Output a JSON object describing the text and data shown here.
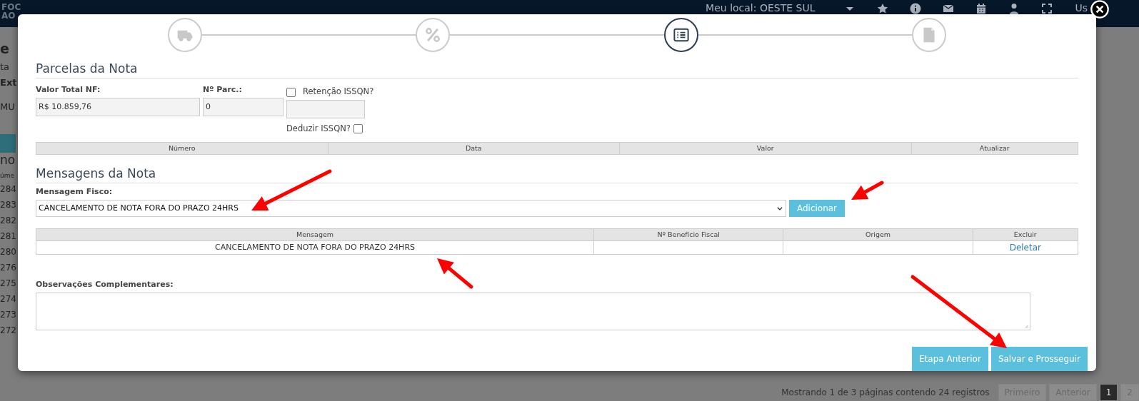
{
  "background_page": {
    "navbar": {
      "logo": [
        "FOC",
        "AO"
      ],
      "location": "Meu local: OESTE SUL",
      "user": "Us"
    },
    "title": "e",
    "labels": [
      "ta",
      "Ext"
    ],
    "field": "MU",
    "section": "no",
    "table": {
      "column_1": "úme",
      "rows": [
        "284",
        "283",
        "282",
        "281",
        "280",
        "276",
        "275",
        "274",
        "273",
        "272"
      ]
    },
    "footer": {
      "summary": "Mostrando 1 de 3 páginas contendo 24 registros",
      "pagination": [
        {
          "label": "Primeiro",
          "selected": false
        },
        {
          "label": "Anterior",
          "selected": false
        },
        {
          "label": "1",
          "selected": true
        },
        {
          "label": "2",
          "selected": false
        }
      ]
    }
  },
  "modal": {
    "steps": [
      {
        "kind": "truck",
        "selected": false
      },
      {
        "kind": "percent",
        "selected": false
      },
      {
        "kind": "list",
        "selected": true
      },
      {
        "kind": "document",
        "selected": false
      }
    ],
    "parcelas": {
      "heading": "Parcelas da Nota",
      "valor_total": {
        "label": "Valor Total NF:",
        "value": "R$ 10.859,76"
      },
      "num_parcelas": {
        "label": "Nº Parc.:",
        "value": "0"
      },
      "retencao": {
        "label": "Retenção ISSQN?",
        "checked": false
      },
      "deduzir": {
        "label": "Deduzir ISSQN?",
        "checked": false
      },
      "table": {
        "columns": [
          "Número",
          "Data",
          "Valor",
          "Atualizar"
        ]
      }
    },
    "mensagens": {
      "heading": "Mensagens da Nota",
      "select_label": "Mensagem Fisco:",
      "select_value": "CANCELAMENTO DE NOTA FORA DO PRAZO 24HRS",
      "add_button": "Adicionar",
      "table": {
        "columns": [
          "Mensagem",
          "Nº Benefício Fiscal",
          "Origem",
          "Excluir"
        ],
        "rows": [
          {
            "mensagem": "CANCELAMENTO DE NOTA FORA DO PRAZO 24HRS",
            "action": "Deletar"
          }
        ]
      }
    },
    "observacoes_label": "Observações Complementares:",
    "buttons": [
      "Etapa Anterior",
      "Salvar e Prosseguir"
    ]
  }
}
